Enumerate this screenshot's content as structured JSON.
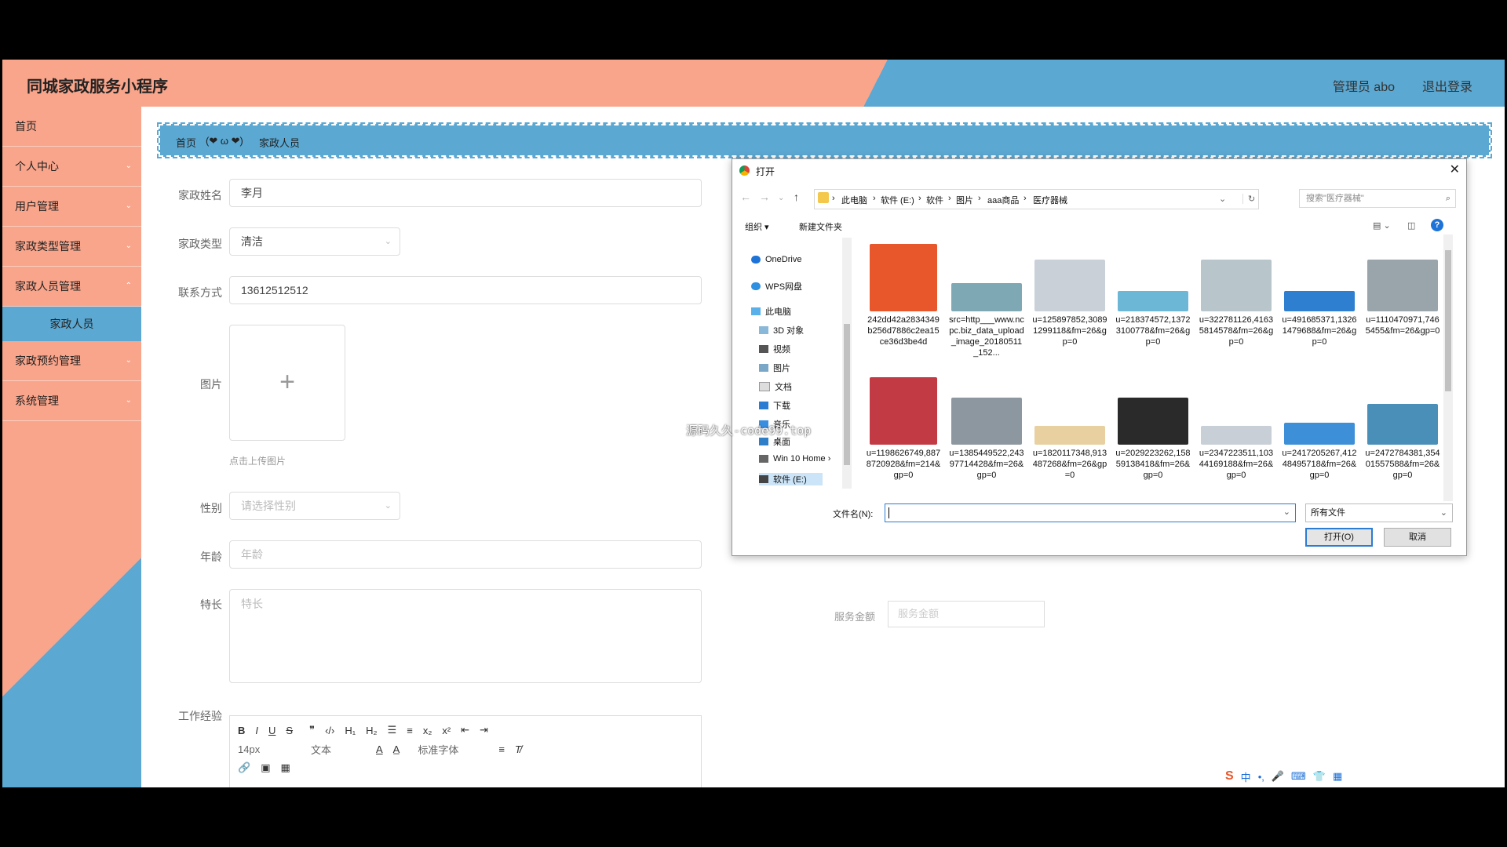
{
  "header": {
    "title": "同城家政服务小程序",
    "admin": "管理员 abo",
    "logout": "退出登录"
  },
  "sidebar": {
    "items": [
      {
        "label": "首页"
      },
      {
        "label": "个人中心"
      },
      {
        "label": "用户管理"
      },
      {
        "label": "家政类型管理"
      },
      {
        "label": "家政人员管理"
      },
      {
        "label": "家政人员"
      },
      {
        "label": "家政预约管理"
      },
      {
        "label": "系统管理"
      }
    ]
  },
  "breadcrumb": {
    "home": "首页",
    "emoticon": "(❤ ω ❤)",
    "current": "家政人员"
  },
  "form": {
    "name_label": "家政姓名",
    "name_value": "李月",
    "type_label": "家政类型",
    "type_value": "清洁",
    "phone_label": "联系方式",
    "phone_value": "13612512512",
    "image_label": "图片",
    "upload_plus": "+",
    "upload_hint": "点击上传图片",
    "gender_label": "性别",
    "gender_placeholder": "请选择性别",
    "age_label": "年龄",
    "age_placeholder": "年龄",
    "skill_label": "特长",
    "skill_placeholder": "特长",
    "exp_label": "工作经验",
    "fee_label": "服务金额",
    "fee_placeholder": "服务金额"
  },
  "editor": {
    "font_size": "14px",
    "text_type": "文本",
    "font_family": "标准字体"
  },
  "dialog": {
    "title": "打开",
    "path": [
      "此电脑",
      "软件 (E:)",
      "软件",
      "图片",
      "aaa商品",
      "医疗器械"
    ],
    "search_placeholder": "搜索\"医疗器械\"",
    "organize": "组织 ▾",
    "new_folder": "新建文件夹",
    "tree": [
      {
        "label": "OneDrive"
      },
      {
        "label": "WPS网盘"
      },
      {
        "label": "此电脑"
      },
      {
        "label": "3D 对象"
      },
      {
        "label": "视频"
      },
      {
        "label": "图片"
      },
      {
        "label": "文档"
      },
      {
        "label": "下载"
      },
      {
        "label": "音乐"
      },
      {
        "label": "桌面"
      },
      {
        "label": "Win 10 Home ›"
      },
      {
        "label": "软件 (E:)"
      }
    ],
    "files": [
      {
        "name": "242dd42a2834349b256d7886c2ea15ce36d3be4d",
        "color": "#e8572b"
      },
      {
        "name": "src=http___www.ncpc.biz_data_upload_image_20180511_152...",
        "color": "#7fa8b5"
      },
      {
        "name": "u=125897852,30891299118&fm=26&gp=0",
        "color": "#c9d0d8"
      },
      {
        "name": "u=218374572,13723100778&fm=26&gp=0",
        "color": "#6cb7d6"
      },
      {
        "name": "u=322781126,41635814578&fm=26&gp=0",
        "color": "#b8c6cc"
      },
      {
        "name": "u=491685371,13261479688&fm=26&gp=0",
        "color": "#2f7fd0"
      },
      {
        "name": "u=1110470971,7465455&fm=26&gp=0",
        "color": "#9aa4ab"
      },
      {
        "name": "u=1198626749,8878720928&fm=214&gp=0",
        "color": "#c23a44"
      },
      {
        "name": "u=1385449522,24397714428&fm=26&gp=0",
        "color": "#8d97a0"
      },
      {
        "name": "u=1820117348,913487268&fm=26&gp=0",
        "color": "#e8d0a0"
      },
      {
        "name": "u=2029223262,15859138418&fm=26&gp=0",
        "color": "#2a2a2a"
      },
      {
        "name": "u=2347223511,10344169188&fm=26&gp=0",
        "color": "#c8cfd6"
      },
      {
        "name": "u=2417205267,41248495718&fm=26&gp=0",
        "color": "#3d8fd8"
      },
      {
        "name": "u=2472784381,35401557588&fm=26&gp=0",
        "color": "#4a8fb8"
      }
    ],
    "filename_label": "文件名(N):",
    "filetype": "所有文件",
    "open_btn": "打开(O)",
    "cancel_btn": "取消"
  },
  "overlay": {
    "watermark_text": "源码久久-code99.top"
  },
  "taskbar": {
    "ime_label": "中"
  },
  "colors": {
    "salmon": "#f9a58b",
    "blue": "#5ba8d2"
  }
}
